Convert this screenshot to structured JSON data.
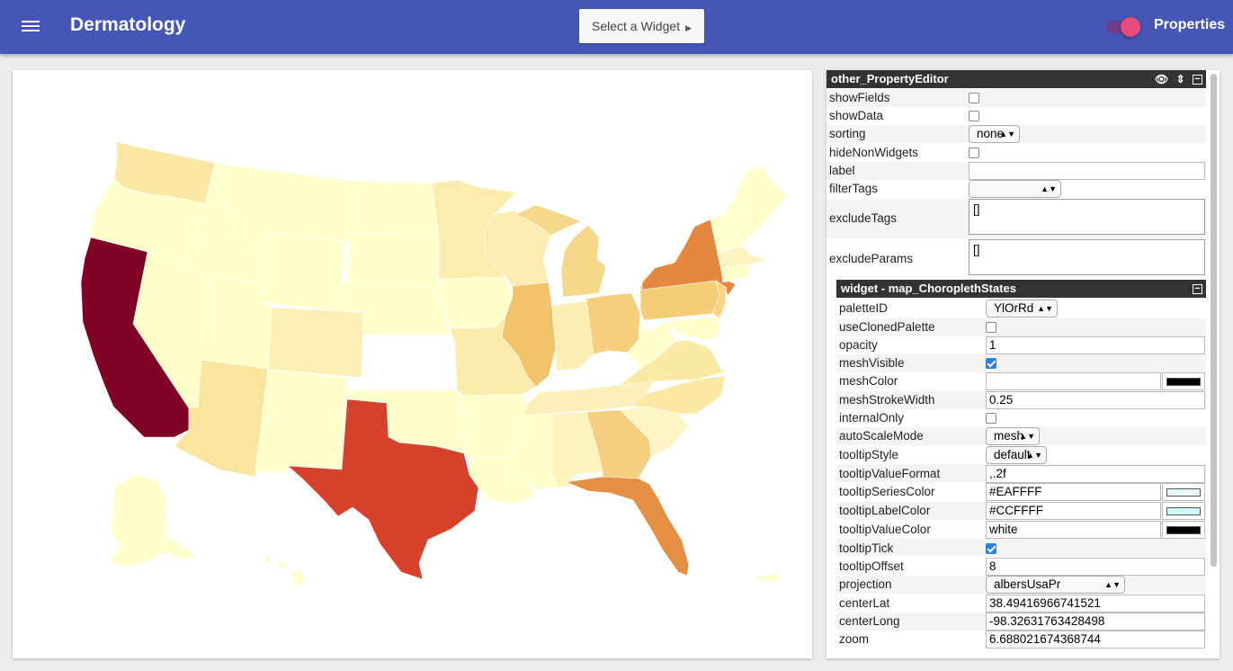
{
  "header": {
    "app_title": "Dermatology",
    "select_widget_label": "Select a Widget",
    "properties_label": "Properties",
    "properties_toggle_on": true,
    "bar_color": "#4556b6",
    "toggle_color": "#e94b7d"
  },
  "map": {
    "palette": "YlOrRd",
    "state_colors": {
      "california": "#800026",
      "texas": "#d7412b",
      "new-york": "#e5883f",
      "florida": "#e58f45",
      "illinois": "#f3c36a",
      "pennsylvania": "#f5cc78",
      "ohio": "#f5cf7c",
      "georgia": "#f5cf80",
      "new-jersey": "#f7d585",
      "michigan": "#f7d88a",
      "arizona": "#f9e59d",
      "washington": "#f9e7a3",
      "north-carolina": "#fae8a3",
      "virginia": "#faeaa6",
      "missouri": "#fbecab",
      "minnesota": "#fbedae",
      "wisconsin": "#fbedb1",
      "indiana": "#fbeeb3",
      "colorado": "#fbefb5",
      "tennessee": "#fcf0b8",
      "alabama": "#fcf3bd",
      "massachusetts": "#fcf3bf",
      "south-carolina": "#fcf4c2",
      "kentucky": "#ffffff",
      "kansas": "#ffffff",
      "default": "#ffffcc"
    }
  },
  "editor": {
    "title": "other_PropertyEditor",
    "eye_icon": "eye-icon",
    "sort_icon": "sort-icon",
    "collapse_icon": "collapse-icon",
    "rows": {
      "showFields": {
        "label": "showFields",
        "checked": false
      },
      "showData": {
        "label": "showData",
        "checked": false
      },
      "sorting": {
        "label": "sorting",
        "value": "none"
      },
      "hideNonWidgets": {
        "label": "hideNonWidgets",
        "checked": false
      },
      "label": {
        "label": "label",
        "value": ""
      },
      "filterTags": {
        "label": "filterTags",
        "value": ""
      },
      "excludeTags": {
        "label": "excludeTags",
        "value": "[]"
      },
      "excludeParams": {
        "label": "excludeParams",
        "value": "[]"
      }
    }
  },
  "widget": {
    "title": "widget - map_ChoroplethStates",
    "rows": {
      "paletteID": {
        "label": "paletteID",
        "value": "YlOrRd"
      },
      "useClonedPalette": {
        "label": "useClonedPalette",
        "checked": false
      },
      "opacity": {
        "label": "opacity",
        "value": "1"
      },
      "meshVisible": {
        "label": "meshVisible",
        "checked": true
      },
      "meshColor": {
        "label": "meshColor",
        "value": "",
        "swatch": "#000000"
      },
      "meshStrokeWidth": {
        "label": "meshStrokeWidth",
        "value": "0.25"
      },
      "internalOnly": {
        "label": "internalOnly",
        "checked": false
      },
      "autoScaleMode": {
        "label": "autoScaleMode",
        "value": "mesh"
      },
      "tooltipStyle": {
        "label": "tooltipStyle",
        "value": "default"
      },
      "tooltipValueFormat": {
        "label": "tooltipValueFormat",
        "value": ",.2f"
      },
      "tooltipSeriesColor": {
        "label": "tooltipSeriesColor",
        "value": "#EAFFFF",
        "swatch": "#EAFFFF"
      },
      "tooltipLabelColor": {
        "label": "tooltipLabelColor",
        "value": "#CCFFFF",
        "swatch": "#CCFFFF"
      },
      "tooltipValueColor": {
        "label": "tooltipValueColor",
        "value": "white",
        "swatch": "#000000"
      },
      "tooltipTick": {
        "label": "tooltipTick",
        "checked": true
      },
      "tooltipOffset": {
        "label": "tooltipOffset",
        "value": "8"
      },
      "projection": {
        "label": "projection",
        "value": "albersUsaPr"
      },
      "centerLat": {
        "label": "centerLat",
        "value": "38.49416966741521"
      },
      "centerLong": {
        "label": "centerLong",
        "value": "-98.32631763428498"
      },
      "zoom": {
        "label": "zoom",
        "value": "6.688021674368744"
      }
    }
  }
}
